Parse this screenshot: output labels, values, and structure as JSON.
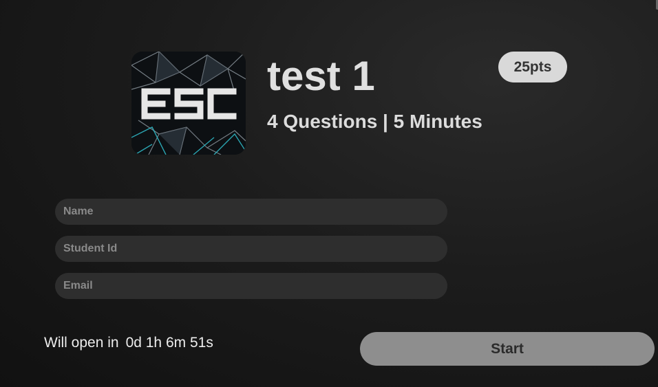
{
  "quiz": {
    "logo_text": "ESC",
    "title": "test 1",
    "subtitle": "4 Questions | 5 Minutes",
    "points": "25pts"
  },
  "form": {
    "name_placeholder": "Name",
    "name_value": "",
    "student_id_placeholder": "Student Id",
    "student_id_value": "",
    "email_placeholder": "Email",
    "email_value": ""
  },
  "footer": {
    "countdown_label": "Will open in",
    "countdown_value": "0d 1h 6m 51s",
    "start_label": "Start"
  },
  "colors": {
    "background": "#1c1c1c",
    "field_bg": "#2e2e2e",
    "badge_bg": "#d9d9d9",
    "start_bg": "#8e8e8e"
  }
}
